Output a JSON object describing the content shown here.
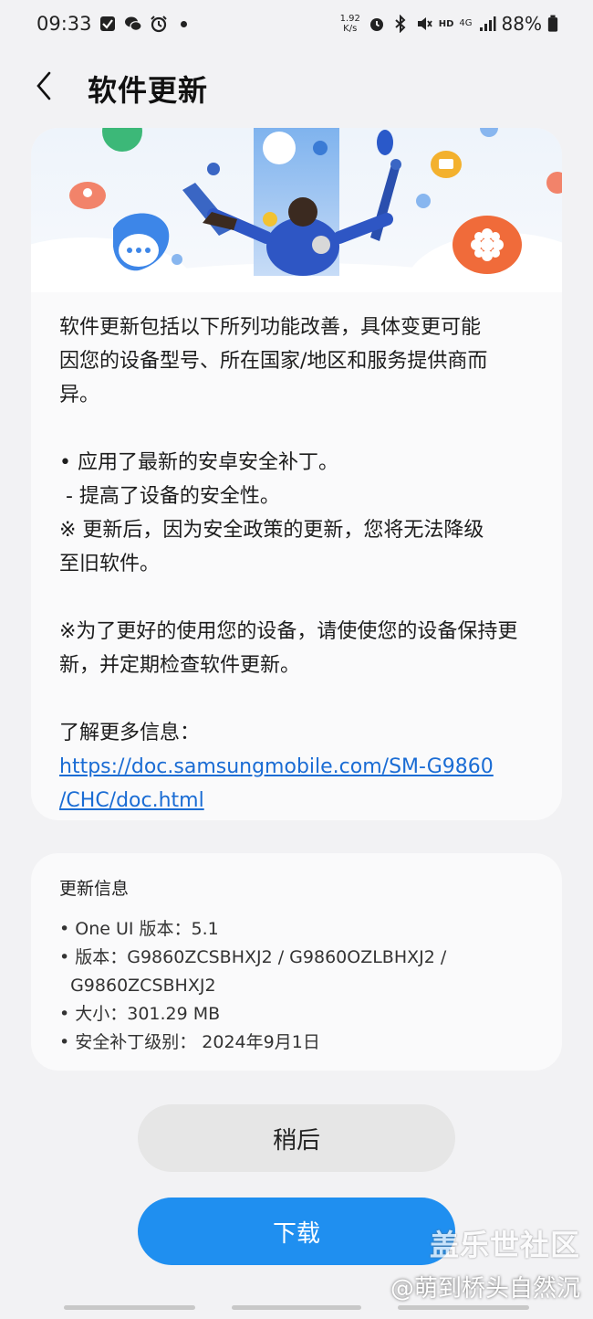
{
  "status_bar": {
    "time": "09:33",
    "net_speed_value": "1.92",
    "net_speed_unit": "K/s",
    "hd_label": "HD",
    "network_type": "4G",
    "battery_percent": "88%"
  },
  "header": {
    "title": "软件更新"
  },
  "release_notes": {
    "intro_lines": [
      "软件更新包括以下所列功能改善，具体变更可能",
      "因您的设备型号、所在国家/地区和服务提供商而",
      "异。"
    ],
    "bullet_1": "• 应用了最新的安卓安全补丁。",
    "bullet_1_sub": " - 提高了设备的安全性。",
    "note_line_1": "※ 更新后，因为安全政策的更新，您将无法降级",
    "note_line_2": "至旧软件。",
    "note2_line_1": "※为了更好的使用您的设备，请使使您的设备保持更",
    "note2_line_2": "新，并定期检查软件更新。",
    "more_info_label": "了解更多信息：",
    "link_line_1": "https://doc.samsungmobile.com/SM-G9860",
    "link_line_2": "/CHC/doc.html"
  },
  "update_info": {
    "title": "更新信息",
    "items": [
      "• One UI 版本：5.1",
      "• 版本：G9860ZCSBHXJ2 / G9860OZLBHXJ2 /",
      "  G9860ZCSBHXJ2",
      "• 大小：301.29 MB",
      "• 安全补丁级别： 2024年9月1日"
    ]
  },
  "buttons": {
    "later_label": "稍后",
    "download_label": "下载"
  },
  "watermark": {
    "line1": "盖乐世社区",
    "line2": "@萌到桥头自然沉"
  },
  "colors": {
    "accent": "#1f8ff0",
    "link": "#1a6cd4",
    "background": "#f2f2f4",
    "card": "#fafafb"
  }
}
